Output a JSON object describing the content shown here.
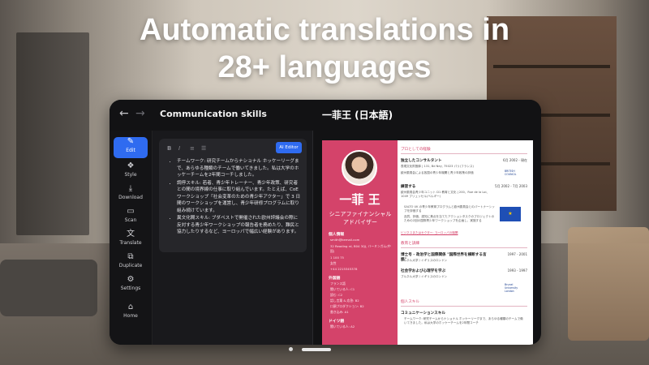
{
  "headline": {
    "line1": "Automatic translations in",
    "line2": "28+ languages"
  },
  "topbar": {
    "back": "←",
    "forward": "→",
    "doc_title": "Communication skills",
    "lang_title": "一菲王 (日本語)"
  },
  "sidebar": {
    "items": [
      {
        "label": "Edit",
        "icon": "✎"
      },
      {
        "label": "Style",
        "icon": "❖"
      },
      {
        "label": "Download",
        "icon": "⤓"
      },
      {
        "label": "Scan",
        "icon": "▭"
      },
      {
        "label": "Translate",
        "icon": "文"
      },
      {
        "label": "Duplicate",
        "icon": "⧉"
      },
      {
        "label": "Settings",
        "icon": "⚙"
      },
      {
        "label": "Home",
        "icon": "⌂"
      }
    ]
  },
  "editor": {
    "toolbar": {
      "bold": "B",
      "italic": "I",
      "list1": "≡",
      "list2": "☰",
      "ai_label": "AI Editor"
    },
    "bullets": [
      "チームワーク: 研究チームからナショナル ホッケーリーグまで、あらゆる種類のチームで働いてきました。私は大学のホッケーチームを2年間コーチしました。",
      "調停スキル: 若者、青少年トレーナー、青少年政策、研究者との間の境界線の仕事に取り組んでいます。たとえば、CoE ワークショップ「社会変革のための青少年アクター」で 3 日間のワークショップを運営し、青少年研修プログラムに取り組み続けています。",
      "異文化間スキル: ブダペストで開催された欧州評議会の際に反対する青少年ワークショップの報告者を務めたり、難民と協力したりするなど、ヨーロッパで幅広い経験があります。"
    ]
  },
  "resume": {
    "name": "一菲 王",
    "role": "シニアファイナンシャルアドバイザー",
    "contact_head": "個人情報",
    "contact": [
      "smith@kemail.com",
      "32 Reading rd, B04 3QJ, バーミンガム(中国)",
      "1 100 75",
      "女性",
      "+44 2215345378"
    ],
    "lang_head": "外国語",
    "langs": [
      "フランス語",
      "聞いている人: C1",
      "読む: C2",
      "話し言葉 & 応答: B2",
      "口頭プロダクション: B2",
      "書き込み: A1"
    ],
    "lang2_head": "ドイツ語",
    "langs2": [
      "聞いている人: A2"
    ],
    "right": {
      "head1": "プロとしての経験",
      "job1_title": "独立したコンサルタント",
      "job1_date": "6月 2002 - 現在",
      "job1_place": "表現文化財團体 | 131, Bd Ney, 75023 パリ(フランス)",
      "job1_desc": "欧州委員会による各国の青少年機関と青少年政策の評価",
      "badge1": "BRITISH COUNCIL",
      "job2_title": "練習する",
      "job2_date": "5月 2002 - 7月 2003",
      "job2_place": "欧州委員会青少年ユニット D1 教育と文化 | 200、Rue de la Loi、1049 ブリュッセル(ベルギー)",
      "job2_bullets": [
        "SALTO UK の青少年教育プログラムと欧州委員会とのパートナーシップを評価する",
        "品質、評価、認知に焦点を当てたアクションタスクのプロジェクトのための2回の国際青少年ワークショップを企画し、実施する"
      ],
      "eu_flag": "★",
      "link1": "ビジネスまたはセクター: ヨーロッパの機関",
      "head2": "教育と訓練",
      "edu1_title": "博士号 - 政治学と国際関係 \"国際世界を横断する言語\"",
      "edu1_date": "1997 - 2001",
      "edu1_place": "ブルネル大学 / イギリスのロンドン",
      "edu2_title": "社会学および心理学を学ぶ",
      "edu2_date": "1993 - 1997",
      "edu2_place": "ブルネル大学 / イギリスのロンドン",
      "badge2": "Brunel University London",
      "head3": "個人スキル",
      "skill_title": "コミュニケーションスキル",
      "skill_desc": "チームワーク: 研究チームからナショナル ホッケーリーグまで、あらゆる種類のチームで働いてきました。私は大学のホッケーチームを2年間コーチ"
    }
  }
}
